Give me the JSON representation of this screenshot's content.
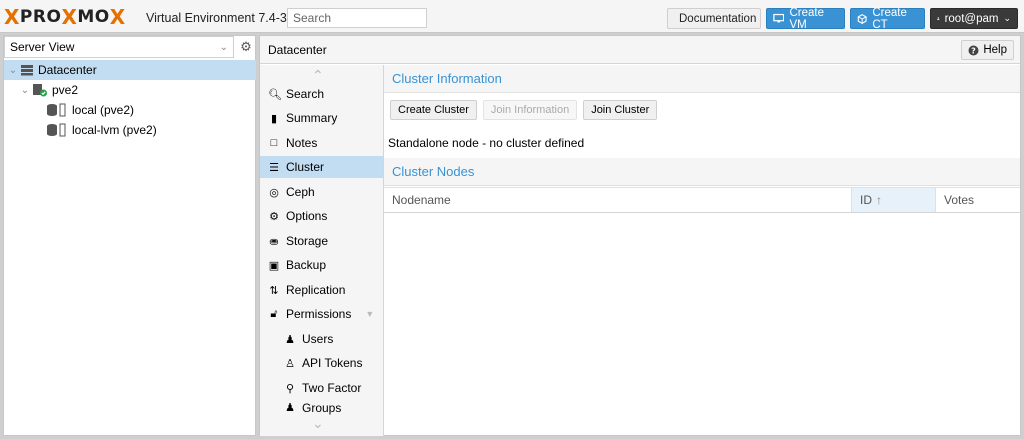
{
  "topbar": {
    "logo_x1": "X",
    "logo_prox": "PRO",
    "logo_x2": "X",
    "logo_mo": "MO",
    "logo_x3": "X",
    "version": "Virtual Environment 7.4-3",
    "search_placeholder": "Search",
    "documentation": "Documentation",
    "create_vm": "Create VM",
    "create_ct": "Create CT",
    "user": "root@pam"
  },
  "left": {
    "view": "Server View",
    "tree": [
      {
        "label": "Datacenter"
      },
      {
        "label": "pve2"
      },
      {
        "label": "local (pve2)"
      },
      {
        "label": "local-lvm (pve2)"
      }
    ]
  },
  "crumb": {
    "title": "Datacenter",
    "help": "Help"
  },
  "nav": {
    "items": [
      {
        "label": "Search",
        "icon": "search-icon"
      },
      {
        "label": "Summary",
        "icon": "book-icon"
      },
      {
        "label": "Notes",
        "icon": "note-icon"
      },
      {
        "label": "Cluster",
        "icon": "server-icon"
      },
      {
        "label": "Ceph",
        "icon": "ceph-icon"
      },
      {
        "label": "Options",
        "icon": "gear-icon"
      },
      {
        "label": "Storage",
        "icon": "database-icon"
      },
      {
        "label": "Backup",
        "icon": "floppy-icon"
      },
      {
        "label": "Replication",
        "icon": "retweet-icon"
      },
      {
        "label": "Permissions",
        "icon": "unlock-icon"
      },
      {
        "label": "Users",
        "icon": "user-icon"
      },
      {
        "label": "API Tokens",
        "icon": "user-outline-icon"
      },
      {
        "label": "Two Factor",
        "icon": "key-icon"
      },
      {
        "label": "Groups",
        "icon": "users-icon"
      }
    ]
  },
  "main": {
    "cluster_info": "Cluster Information",
    "create_cluster": "Create Cluster",
    "join_information": "Join Information",
    "join_cluster": "Join Cluster",
    "standalone": "Standalone node - no cluster defined",
    "cluster_nodes": "Cluster Nodes",
    "columns": {
      "nodename": "Nodename",
      "id": "ID",
      "votes": "Votes"
    }
  },
  "colors": {
    "accent": "#3892d4",
    "selection": "#c2ddf2",
    "logo_orange": "#e57000"
  }
}
